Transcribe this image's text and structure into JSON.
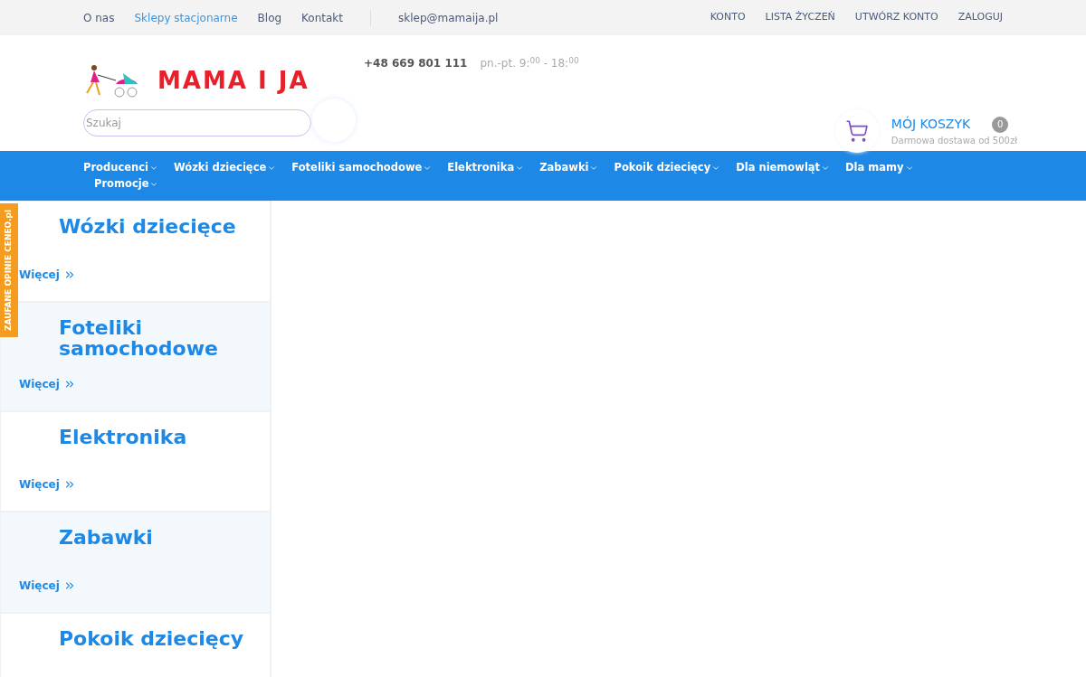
{
  "top_bar": {
    "links": [
      {
        "label": "O nas",
        "selected": false
      },
      {
        "label": "Sklepy stacjonarne",
        "selected": true
      },
      {
        "label": "Blog",
        "selected": false
      },
      {
        "label": "Kontakt",
        "selected": false
      }
    ],
    "email": "sklep@mamaija.pl",
    "account_links": [
      "KONTO",
      "LISTA ŻYCZEŃ",
      "UTWÓRZ KONTO",
      "ZALOGUJ"
    ]
  },
  "header": {
    "logo_text": "MAMA I JA",
    "phone": "+48 669 801 111",
    "hours": "pn.-pt. 9:$^{00}$ - 18:$^{00}$",
    "search": {
      "placeholder": "Szukaj"
    },
    "cart": {
      "title": "MÓJ KOSZYK",
      "count": "0",
      "note": "Darmowa dostawa od 500zł"
    }
  },
  "nav": [
    "Producenci",
    "Wózki dziecięce",
    "Foteliki samochodowe",
    "Elektronika",
    "Zabawki",
    "Pokoik dziecięcy",
    "Dla niemowląt",
    "Dla mamy",
    "Promocje"
  ],
  "ceneo_tab": "ZAUFANE OPINIE CENEO.pl",
  "categories": [
    {
      "title": "Wózki dziecięce",
      "link": "Więcej"
    },
    {
      "title": "Foteliki samochodowe",
      "link": "Więcej"
    },
    {
      "title": "Elektronika",
      "link": "Więcej"
    },
    {
      "title": "Zabawki",
      "link": "Więcej"
    },
    {
      "title": "Pokoik dziecięcy"
    }
  ]
}
